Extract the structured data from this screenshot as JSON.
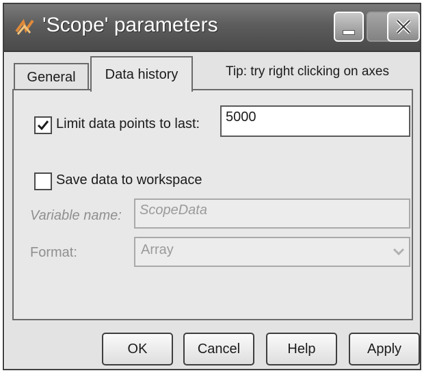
{
  "window": {
    "title": "'Scope' parameters"
  },
  "tabs": [
    {
      "label": "General",
      "selected": false
    },
    {
      "label": "Data history",
      "selected": true
    }
  ],
  "tip": "Tip: try right clicking on axes",
  "limit_points": {
    "label": "Limit data points to last:",
    "checked": true,
    "value": "5000"
  },
  "save_workspace": {
    "label": "Save data to workspace",
    "checked": false
  },
  "variable_name": {
    "label": "Variable name:",
    "value": "ScopeData",
    "enabled": false
  },
  "format": {
    "label": "Format:",
    "value": "Array",
    "enabled": false
  },
  "buttons": {
    "ok": "OK",
    "cancel": "Cancel",
    "help": "Help",
    "apply": "Apply"
  }
}
